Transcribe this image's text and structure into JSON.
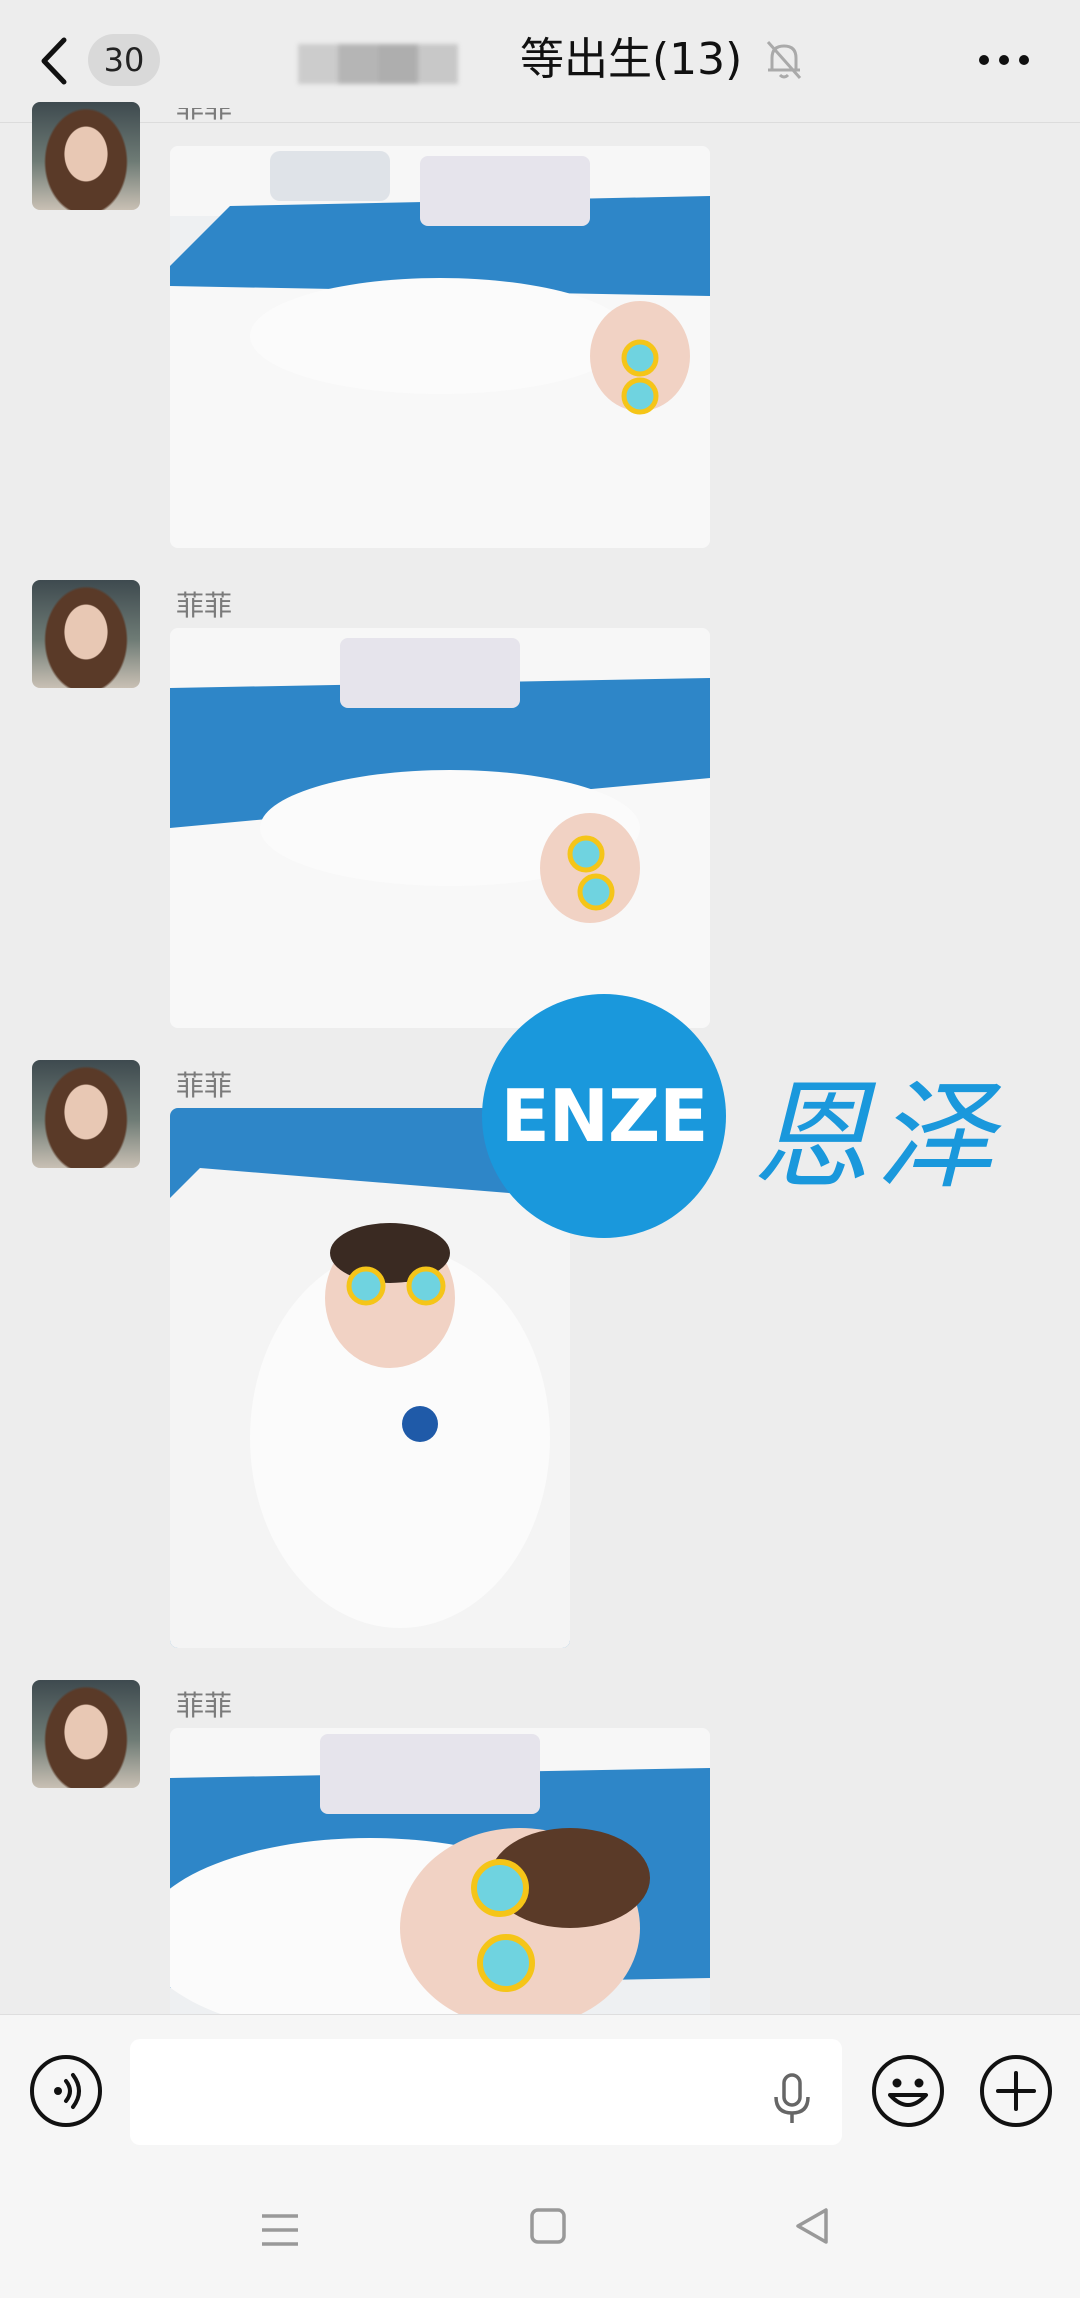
{
  "header": {
    "unread_count": "30",
    "chat_title": "等出生(13)"
  },
  "messages": [
    {
      "sender": "菲菲",
      "type": "photo"
    },
    {
      "sender": "菲菲",
      "type": "photo"
    },
    {
      "sender": "菲菲",
      "type": "photo"
    },
    {
      "sender": "菲菲",
      "type": "photo"
    }
  ],
  "watermark": {
    "logo_text": "ENZE",
    "logo_cn": "恩泽",
    "brand_color": "#1a98dc"
  },
  "input_bar": {
    "value": "",
    "icons": [
      "voice-icon",
      "mic-icon",
      "emoji-icon",
      "plus-icon"
    ]
  },
  "nav_bar": {
    "icons": [
      "menu-icon",
      "home-icon",
      "back-icon"
    ]
  },
  "colors": {
    "background": "#ededed",
    "sunglasses_frame": "#f5c518",
    "sunglasses_lens": "#6fd3e0",
    "blanket_blue": "#2e86c8"
  }
}
